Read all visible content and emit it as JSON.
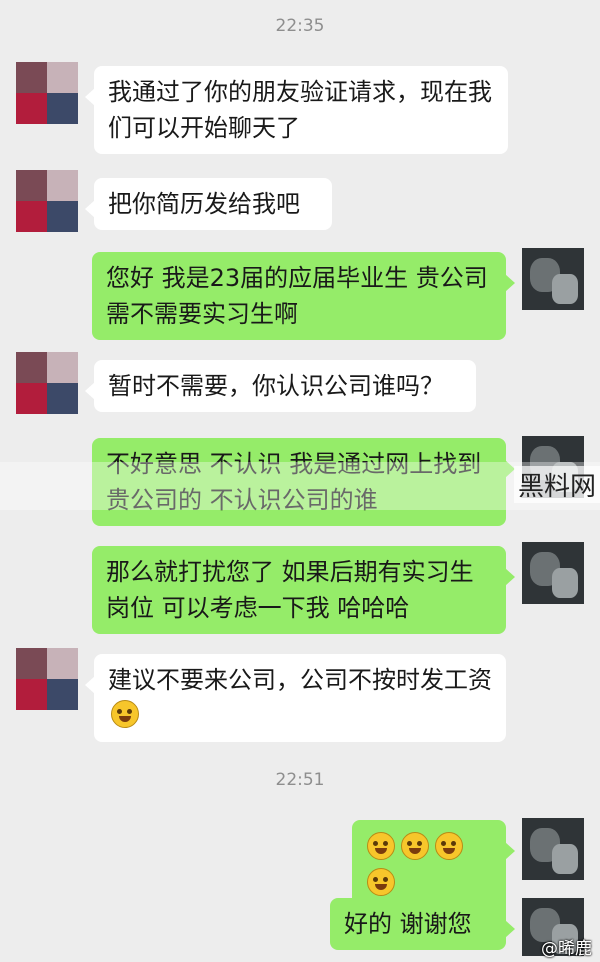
{
  "timestamps": [
    "22:35",
    "22:51"
  ],
  "messages": [
    {
      "side": "left",
      "text": "我通过了你的朋友验证请求，现在我们可以开始聊天了"
    },
    {
      "side": "left",
      "text": "把你简历发给我吧"
    },
    {
      "side": "right",
      "text": "您好 我是23届的应届毕业生 贵公司需不需要实习生啊"
    },
    {
      "side": "left",
      "text": "暂时不需要，你认识公司谁吗？"
    },
    {
      "side": "right",
      "text": "不好意思 不认识 我是通过网上找到贵公司的 不认识公司的谁"
    },
    {
      "side": "right",
      "text": "那么就打扰您了 如果后期有实习生岗位 可以考虑一下我 哈哈哈"
    },
    {
      "side": "left",
      "text": "建议不要来公司，公司不按时发工资",
      "emoji": "smile-emoji"
    },
    {
      "side": "right",
      "emoji": "grin-sweat-emoji",
      "emoji_count": 4
    },
    {
      "side": "right",
      "text": "好的 谢谢您"
    }
  ],
  "watermark": {
    "site": "黑料网",
    "weibo": "@晞鹿"
  },
  "colors": {
    "background": "#ededed",
    "outgoing": "#95ec69",
    "incoming": "#ffffff"
  }
}
